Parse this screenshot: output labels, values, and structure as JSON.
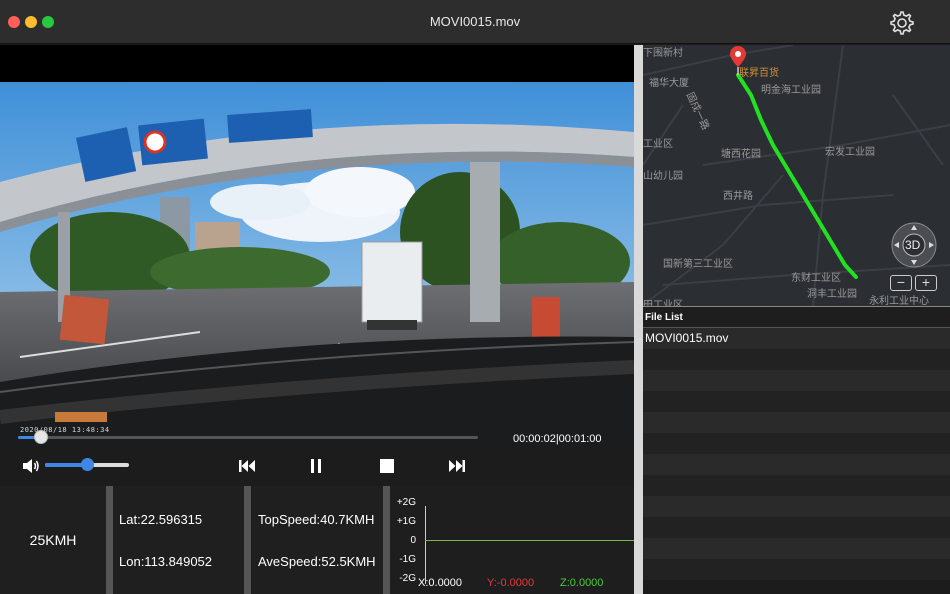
{
  "window": {
    "title": "MOVI0015.mov",
    "settings_icon": "gear-icon"
  },
  "video": {
    "timestamp_overlay": "2020/08/18  13:48:34",
    "progress_fraction": 0.05,
    "timecode": "00:00:02|00:01:00"
  },
  "controls": {
    "volume_icon": "speaker-icon",
    "volume_level": 0.5,
    "buttons": [
      "previous-icon",
      "pause-icon",
      "stop-icon",
      "next-icon"
    ]
  },
  "telemetry": {
    "speed": "25KMH",
    "lat": "Lat:22.596315",
    "lon": "Lon:113.849052",
    "top_speed": "TopSpeed:40.7KMH",
    "ave_speed": "AveSpeed:52.5KMH",
    "gsensor": {
      "labels": [
        "+2G",
        "+1G",
        "0",
        "-1G",
        "-2G"
      ],
      "x": "X:0.0000",
      "y": "Y:-0.0000",
      "z": "Z:0.0000",
      "colors": {
        "x": "#ffffff",
        "y": "#e23b3b",
        "z": "#4ccc3a"
      }
    }
  },
  "map": {
    "labels": {
      "l1": "下围新村",
      "l2": "福华大厦",
      "l3": "联昇百货",
      "l4": "明金海工业园",
      "l5": "工业区",
      "l6": "塘西花园",
      "l7": "宏发工业园",
      "l8": "山幼儿园",
      "l9": "西井路",
      "l10": "固戍一路",
      "l11": "国新第三工业区",
      "l12": "东财工业区",
      "l13": "洞丰工业园",
      "l14": "永利工业中心",
      "l15": "田工业区"
    },
    "view_mode": "3D",
    "zoom_out": "−",
    "zoom_in": "+",
    "route_color": "#22e022",
    "pin_color": "#e53935"
  },
  "file_list": {
    "header": "File List",
    "files": [
      "MOVI0015.mov"
    ]
  }
}
